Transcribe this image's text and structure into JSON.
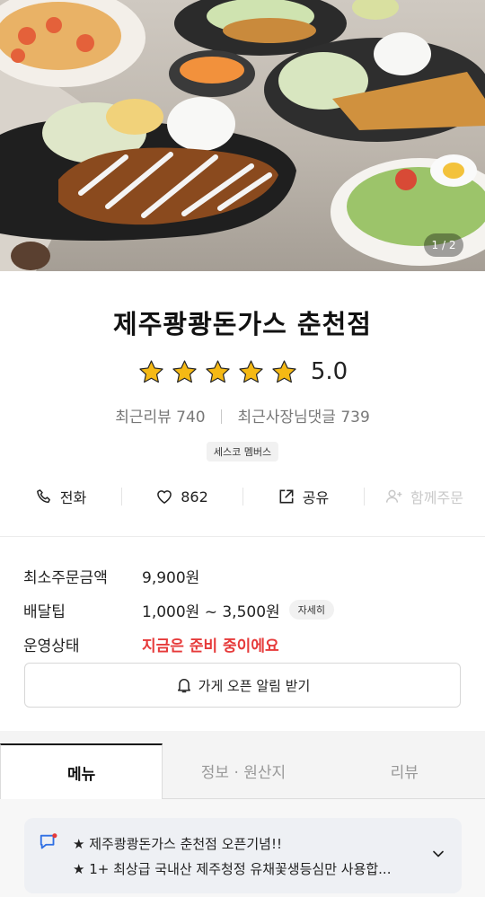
{
  "hero": {
    "page_indicator": "1 / 2"
  },
  "store": {
    "name": "제주쾅쾅돈가스 춘천점",
    "rating": "5.0",
    "stars": 5,
    "recent_reviews_label": "최근리뷰",
    "recent_reviews_count": "740",
    "owner_replies_label": "최근사장님댓글",
    "owner_replies_count": "739",
    "badge": "세스코 멤버스"
  },
  "actions": {
    "call": "전화",
    "like_count": "862",
    "share": "공유",
    "group_order": "함께주문"
  },
  "info": {
    "min_order_label": "최소주문금액",
    "min_order_value": "9,900원",
    "delivery_tip_label": "배달팁",
    "delivery_tip_value": "1,000원 ~ 3,500원",
    "detail_chip": "자세히",
    "status_label": "운영상태",
    "status_value": "지금은 준비 중이에요"
  },
  "alert_button": "가게 오픈 알림 받기",
  "tabs": [
    "메뉴",
    "정보 · 원산지",
    "리뷰"
  ],
  "notice": {
    "line1": "★ 제주쾅쾅돈가스 춘천점 오픈기념!!",
    "line2": "★ 1+ 최상급 국내산 제주청정 유채꽃생등심만 사용합..."
  },
  "colors": {
    "star": "#f5b914",
    "status_closed": "#e63a3a",
    "notice_icon": "#2f6fe4"
  }
}
